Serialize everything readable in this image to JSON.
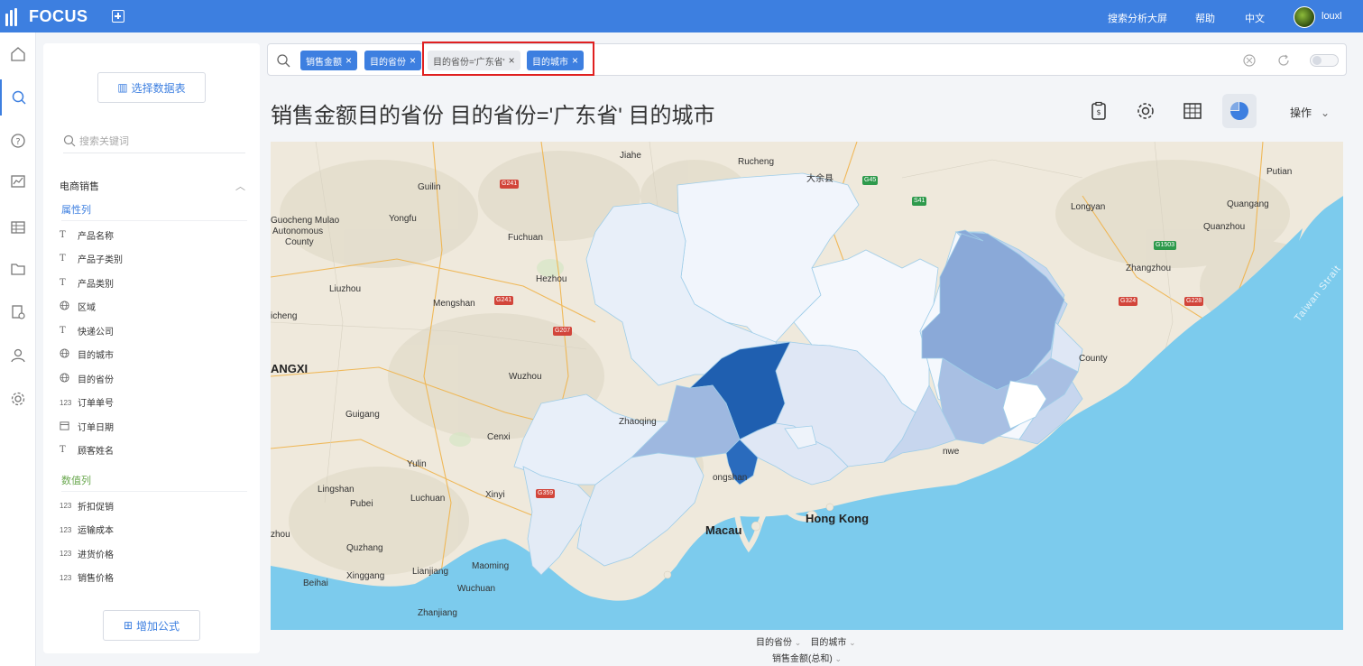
{
  "app": {
    "logo": "FOCUS"
  },
  "topnav": {
    "screen": "搜索分析大屏",
    "help": "帮助",
    "lang": "中文",
    "user": "louxl"
  },
  "panel": {
    "select_table": "选择数据表",
    "search_placeholder": "搜索关键词",
    "group": "电商销售",
    "attr_head": "属性列",
    "attr_fields": [
      {
        "icon": "T",
        "label": "产品名称"
      },
      {
        "icon": "T",
        "label": "产品子类别"
      },
      {
        "icon": "T",
        "label": "产品类别"
      },
      {
        "icon": "globe",
        "label": "区域"
      },
      {
        "icon": "T",
        "label": "快递公司"
      },
      {
        "icon": "globe",
        "label": "目的城市"
      },
      {
        "icon": "globe",
        "label": "目的省份"
      },
      {
        "icon": "123",
        "label": "订单单号"
      },
      {
        "icon": "cal",
        "label": "订单日期"
      },
      {
        "icon": "T",
        "label": "顾客姓名"
      }
    ],
    "num_head": "数值列",
    "num_fields": [
      {
        "icon": "123",
        "label": "折扣促销"
      },
      {
        "icon": "123",
        "label": "运输成本"
      },
      {
        "icon": "123",
        "label": "进货价格"
      },
      {
        "icon": "123",
        "label": "销售价格"
      }
    ],
    "add_formula": "增加公式"
  },
  "search": {
    "tokens": [
      {
        "label": "销售金额",
        "style": "blue"
      },
      {
        "label": "目的省份",
        "style": "blue"
      },
      {
        "label": "目的省份='广东省'",
        "style": "grey"
      },
      {
        "label": "目的城市",
        "style": "blue"
      }
    ]
  },
  "title": "销售金额目的省份 目的省份='广东省' 目的城市",
  "toolbar": {
    "ops": "操作"
  },
  "map": {
    "labels": {
      "jiahe": "Jiahe",
      "rucheng": "Rucheng",
      "dayuxian": "大余县",
      "putian": "Putian",
      "guilin": "Guilin",
      "longyan": "Longyan",
      "quangang": "Quangang",
      "rongshui1": "Guocheng Mulao",
      "rongshui2": "Autonomous",
      "rongshui3": "County",
      "yongfu": "Yongfu",
      "fuchuan": "Fuchuan",
      "quanzhou": "Quanzhou",
      "zhangzhou": "Zhangzhou",
      "hezhou": "Hezhou",
      "liuzhou": "Liuzhou",
      "mengshan": "Mengshan",
      "yicheng": "icheng",
      "strait": "Taiwan Strait",
      "guangxi": "ANGXI",
      "wuzhou": "Wuzhou",
      "county": "County",
      "guigang": "Guigang",
      "zhaoqing": "Zhaoqing",
      "cenxi": "Cenxi",
      "yulin": "Yulin",
      "lingshan": "Lingshan",
      "luchuan": "Luchuan",
      "xinyi": "Xinyi",
      "pubei": "Pubei",
      "dongguan": "ongshan",
      "hongkong": "Hong Kong",
      "shanwei": "nwe",
      "macau": "Macau",
      "qinzhou": "zhou",
      "quzhang": "Quzhang",
      "maoming": "Maoming",
      "lianjiang": "Lianjiang",
      "xingang": "Xinggang",
      "beihai": "Beihai",
      "wuchuan": "Wuchuan",
      "zhanjiang": "Zhanjiang"
    },
    "shields": {
      "g241a": "G241",
      "g45": "G45",
      "s41": "S41",
      "g1503": "G1503",
      "g241b": "G241",
      "g207": "G207",
      "g324": "G324",
      "g228": "G228",
      "g359": "G359"
    }
  },
  "axes": {
    "x1": "目的省份",
    "x2": "目的城市",
    "value": "销售金额(总和)"
  },
  "colors": {
    "accent": "#3d7fe0",
    "water": "#7ccbed",
    "land": "#efe9dc"
  }
}
